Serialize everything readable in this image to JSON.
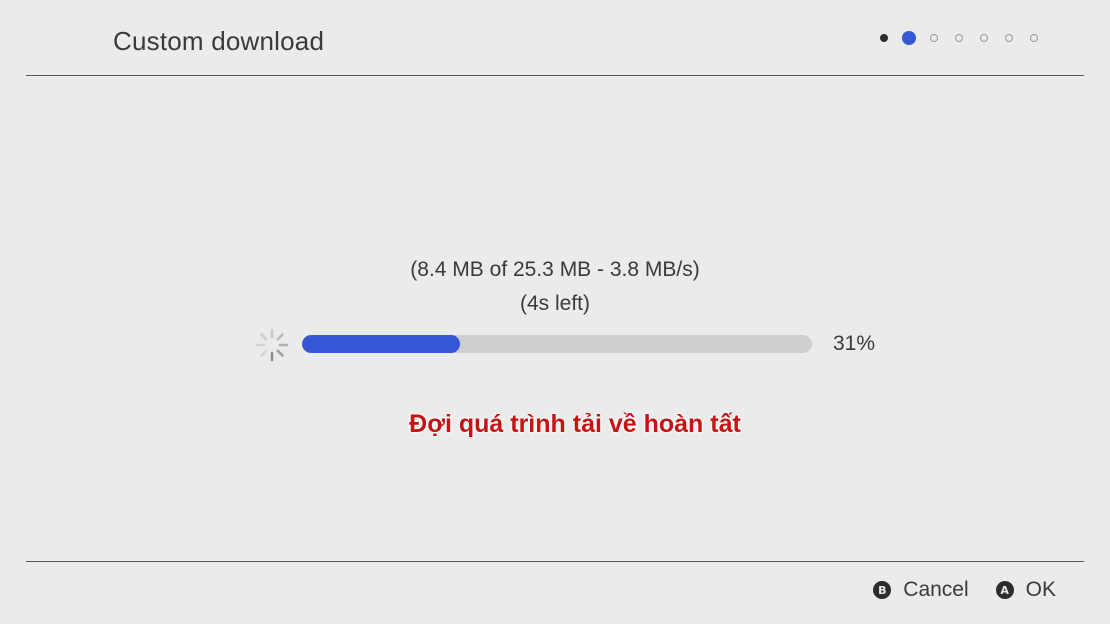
{
  "header": {
    "title": "Custom download",
    "steps": {
      "total": 7,
      "current": 2
    }
  },
  "download": {
    "transfer_text": "(8.4 MB of 25.3 MB - 3.8 MB/s)",
    "time_left_text": "(4s left)",
    "progress_fraction": 0.31,
    "percent_text": "31%"
  },
  "notice": {
    "text": "Đợi quá trình tải về hoàn tất"
  },
  "footer": {
    "cancel": {
      "glyph": "B",
      "label": "Cancel"
    },
    "ok": {
      "glyph": "A",
      "label": "OK"
    }
  },
  "colors": {
    "accent": "#3657d6",
    "notice": "#c41414",
    "background": "#ebebeb"
  },
  "icons": {
    "spinner": "loading-spinner-icon"
  }
}
